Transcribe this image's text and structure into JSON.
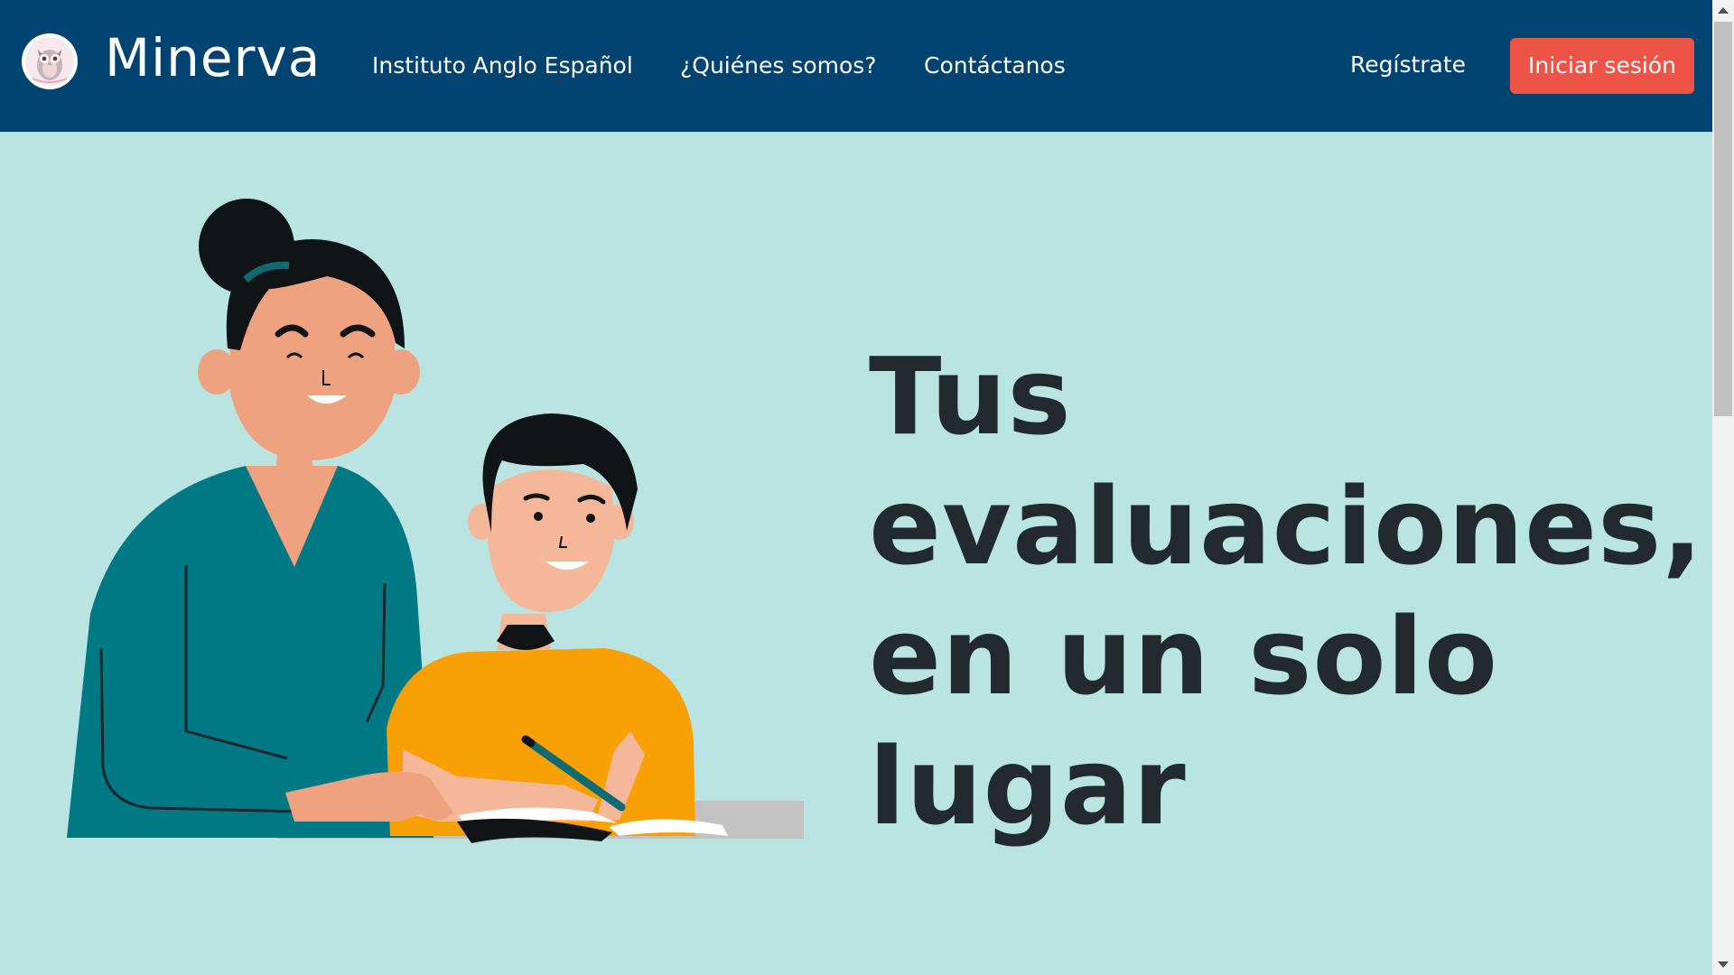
{
  "brand": {
    "name": "Minerva",
    "logo_icon": "owl-logo-icon"
  },
  "nav": {
    "links": [
      "Instituto Anglo Español",
      "¿Quiénes somos?",
      "Contáctanos"
    ],
    "register_label": "Regístrate",
    "login_label": "Iniciar sesión"
  },
  "hero": {
    "headline_lines": [
      "Tus",
      "evaluaciones,",
      "en un solo",
      "lugar"
    ],
    "illustration_icon": "teacher-and-student-illustration"
  },
  "colors": {
    "navbar": "#004370",
    "accent_button": "#ee5347",
    "hero_background": "#b9e4e2",
    "headline_text": "#222a2f"
  }
}
